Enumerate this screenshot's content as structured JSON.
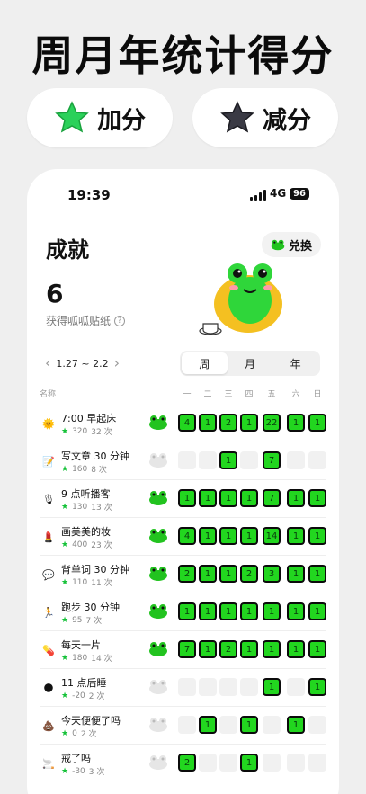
{
  "headline": "周月年统计得分",
  "chips": {
    "add": "加分",
    "sub": "减分"
  },
  "status": {
    "time": "19:39",
    "network": "4G",
    "battery": "96"
  },
  "page": {
    "title": "成就",
    "redeem": "兑换",
    "count": "6",
    "count_label": "获得呱呱贴纸"
  },
  "range": "1.27 ~ 2.2",
  "tabs": [
    "周",
    "月",
    "年"
  ],
  "table": {
    "name_header": "名称",
    "days": [
      "一",
      "二",
      "三",
      "四",
      "五",
      "六",
      "日"
    ],
    "rows": [
      {
        "emoji": "🌞",
        "name": "7:00 早起床",
        "score": "320",
        "times": "32 次",
        "active": true,
        "cells": [
          "4",
          "1",
          "2",
          "1",
          "22",
          "1",
          "1"
        ]
      },
      {
        "emoji": "📝",
        "name": "写文章 30 分钟",
        "score": "160",
        "times": "8 次",
        "active": false,
        "cells": [
          "",
          "",
          "1",
          "",
          "7",
          "",
          ""
        ]
      },
      {
        "emoji": "🎙",
        "name": "9 点听播客",
        "score": "130",
        "times": "13 次",
        "active": true,
        "cells": [
          "1",
          "1",
          "1",
          "1",
          "7",
          "1",
          "1"
        ]
      },
      {
        "emoji": "💄",
        "name": "画美美的妆",
        "score": "400",
        "times": "23 次",
        "active": true,
        "cells": [
          "4",
          "1",
          "1",
          "1",
          "14",
          "1",
          "1"
        ]
      },
      {
        "emoji": "💬",
        "name": "背单词 30 分钟",
        "score": "110",
        "times": "11 次",
        "active": true,
        "cells": [
          "2",
          "1",
          "1",
          "2",
          "3",
          "1",
          "1"
        ]
      },
      {
        "emoji": "🏃",
        "name": "跑步 30 分钟",
        "score": "95",
        "times": "7 次",
        "active": true,
        "cells": [
          "1",
          "1",
          "1",
          "1",
          "1",
          "1",
          "1"
        ]
      },
      {
        "emoji": "💊",
        "name": "每天一片",
        "score": "180",
        "times": "14 次",
        "active": true,
        "cells": [
          "7",
          "1",
          "2",
          "1",
          "1",
          "1",
          "1"
        ]
      },
      {
        "emoji": "🌑",
        "name": "11 点后睡",
        "score": "-20",
        "times": "2 次",
        "active": false,
        "cells": [
          "",
          "",
          "",
          "",
          "1",
          "",
          "1"
        ]
      },
      {
        "emoji": "💩",
        "name": "今天便便了吗",
        "score": "0",
        "times": "2 次",
        "active": false,
        "cells": [
          "",
          "1",
          "",
          "1",
          "",
          "1",
          ""
        ]
      },
      {
        "emoji": "🚬",
        "name": "戒了吗",
        "score": "-30",
        "times": "3 次",
        "active": false,
        "cells": [
          "2",
          "",
          "",
          "1",
          "",
          "",
          ""
        ]
      }
    ]
  },
  "colors": {
    "accent_green": "#22d61f",
    "empty_cell": "#f1f1f1"
  }
}
